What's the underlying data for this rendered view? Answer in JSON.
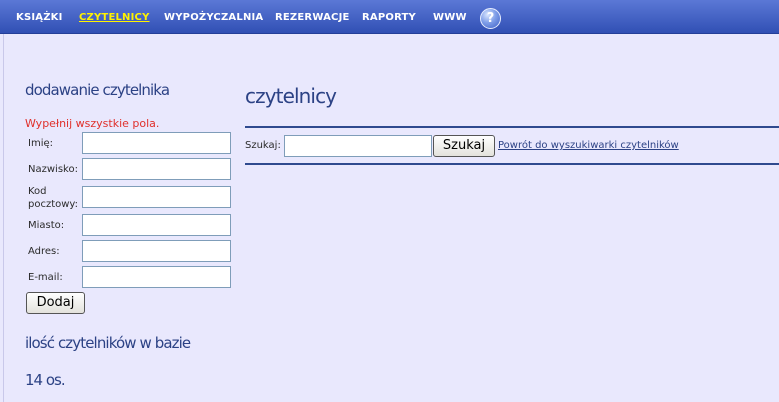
{
  "nav": {
    "items": [
      {
        "label": "KSIĄŻKI"
      },
      {
        "label": "CZYTELNICY"
      },
      {
        "label": "WYPOŻYCZALNIA"
      },
      {
        "label": "REZERWACJE"
      },
      {
        "label": "RAPORTY"
      },
      {
        "label": "WWW"
      }
    ],
    "active": "CZYTELNICY",
    "help_glyph": "?"
  },
  "add_reader": {
    "title": "dodawanie czytelnika",
    "error": "Wypełnij wszystkie pola.",
    "fields": {
      "first_name": {
        "label": "Imię:",
        "value": ""
      },
      "last_name": {
        "label": "Nazwisko:",
        "value": ""
      },
      "postal_code": {
        "label_line1": "Kod",
        "label_line2": "pocztowy:",
        "value": ""
      },
      "city": {
        "label": "Miasto:",
        "value": ""
      },
      "address": {
        "label": "Adres:",
        "value": ""
      },
      "email": {
        "label": "E-mail:",
        "value": ""
      }
    },
    "submit_label": "Dodaj"
  },
  "stats": {
    "title": "ilość czytelników w bazie",
    "value": "14 os."
  },
  "main": {
    "title": "czytelnicy",
    "search": {
      "label": "Szukaj:",
      "value": "",
      "button_label": "Szukaj",
      "back_link": "Powrót do wyszukiwarki czytelników"
    }
  },
  "colors": {
    "nav_bar": "#3f5fc4",
    "nav_active": "#fff200",
    "page_bg": "#e9e8fd",
    "heading": "#2c4285",
    "error": "#e0302b",
    "divider": "#2f4a8f"
  }
}
